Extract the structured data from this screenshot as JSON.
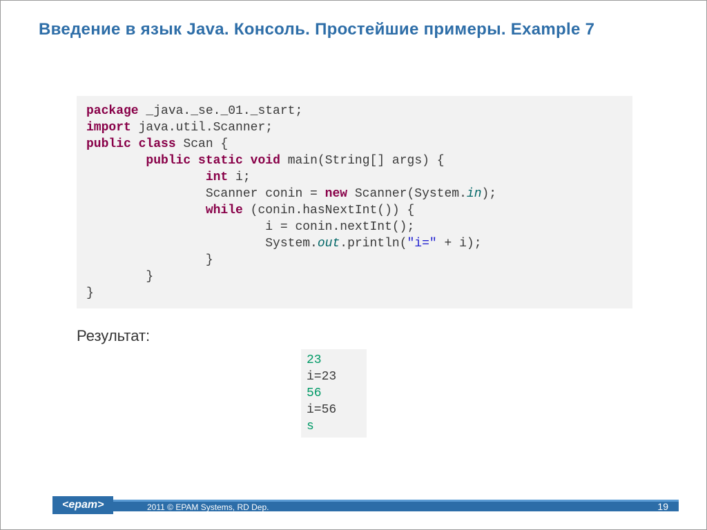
{
  "title": "Введение в язык Java. Консоль. Простейшие примеры. Example 7",
  "code": {
    "pkg_kw": "package",
    "pkg_name": " _java._se._01._start;",
    "imp_kw": "import",
    "imp_name": " java.util.Scanner;",
    "pub": "public",
    "cls": "class",
    "cls_name": " Scan {",
    "stat": "static",
    "void": "void",
    "main_sig": " main(String[] args) {",
    "int_kw": "int",
    "int_rest": " i;",
    "scan_pre": "Scanner conin = ",
    "new_kw": "new",
    "scan_mid": " Scanner(System.",
    "in_fld": "in",
    "scan_end": ");",
    "while_kw": "while",
    "while_cond": " (conin.hasNextInt()) {",
    "assign": "i = conin.nextInt();",
    "sys": "System.",
    "out_fld": "out",
    "println_pre": ".println(",
    "str_lit": "\"i=\"",
    "println_post": " + i);",
    "brace_c": "}",
    "brace_b": "}",
    "brace_a": "}"
  },
  "result_label": "Результат:",
  "output": {
    "l1": "23",
    "l2": "i=23",
    "l3": "56",
    "l4": "i=56",
    "l5": "s"
  },
  "footer": {
    "logo": "<epam>",
    "copyright": "2011 © EPAM Systems, RD Dep.",
    "page": "19"
  }
}
